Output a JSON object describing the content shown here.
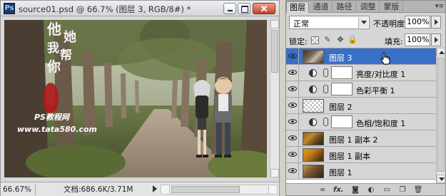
{
  "document": {
    "title": "source01.psd @ 66.7% (图层 3, RGB/8#) *",
    "app_icon": "Ps",
    "status": {
      "zoom": "66.67%",
      "doc_info": "文档:686.6K/3.71M"
    },
    "artwork_text": {
      "vertical_line_1": "他",
      "vertical_line_2": "她",
      "vertical_line_3": "我",
      "vertical_line_4": "帮",
      "vertical_line_5": "你",
      "watermark_line_1": "PS教程网",
      "watermark_line_2": "www.tata580.com"
    }
  },
  "layers_panel": {
    "tabs": [
      {
        "label": "图层",
        "active": true
      },
      {
        "label": "通道",
        "active": false
      },
      {
        "label": "路径",
        "active": false
      },
      {
        "label": "调整",
        "active": false
      },
      {
        "label": "蒙版",
        "active": false
      }
    ],
    "menu_icon": "panel-menu-icon",
    "blend_mode": "正常",
    "opacity_label": "不透明度:",
    "opacity_value": "100%",
    "lock_label": "锁定:",
    "fill_label": "填充:",
    "fill_value": "100%",
    "layers": [
      {
        "name": "图层 3",
        "kind": "pixel",
        "thumb": "selection",
        "selected": true,
        "visible": true
      },
      {
        "name": "亮度/对比度 1",
        "kind": "adjustment",
        "selected": false,
        "visible": true
      },
      {
        "name": "色彩平衡 1",
        "kind": "adjustment",
        "selected": false,
        "visible": true
      },
      {
        "name": "图层 2",
        "kind": "pixel",
        "thumb": "transparent",
        "selected": false,
        "visible": true
      },
      {
        "name": "色相/饱和度 1",
        "kind": "adjustment",
        "selected": false,
        "visible": true
      },
      {
        "name": "图层 1 副本 2",
        "kind": "pixel",
        "thumb": "photo",
        "selected": false,
        "visible": true
      },
      {
        "name": "图层 1 副本",
        "kind": "pixel",
        "thumb": "photo-warm",
        "selected": false,
        "visible": true
      },
      {
        "name": "图层 1",
        "kind": "pixel",
        "thumb": "photo-cool",
        "selected": false,
        "visible": true
      }
    ],
    "bottom_icons": [
      "link-layers-icon",
      "fx",
      "add-mask-icon",
      "adjustment-layer-icon",
      "new-group-icon",
      "new-layer-icon",
      "delete-layer-icon"
    ],
    "bottom_labels": {
      "fx": "fx."
    }
  },
  "colors": {
    "selection_blue": "#3a6fc8",
    "panel_gray": "#d6d6d6",
    "title_gradient_top": "#ecedef",
    "close_red": "#c1432a"
  }
}
